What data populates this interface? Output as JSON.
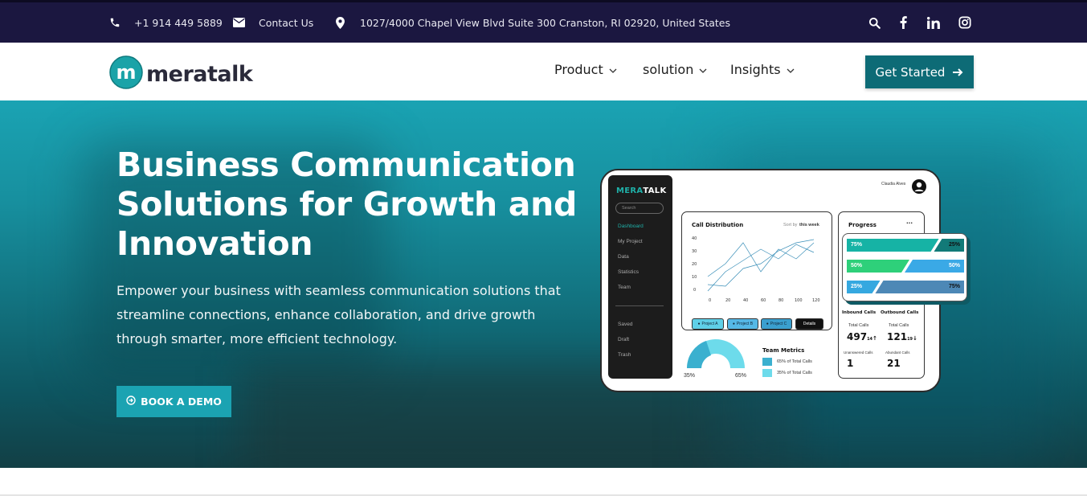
{
  "topbar": {
    "phone": "+1 914 449 5889",
    "contact": "Contact Us",
    "address": "1027/4000 Chapel View Blvd Suite 300 Cranston, RI 02920, United States",
    "icons": [
      "search-icon",
      "facebook-icon",
      "linkedin-icon",
      "instagram-icon"
    ]
  },
  "nav": {
    "logo_text": "meratalk",
    "items": [
      {
        "label": "Product"
      },
      {
        "label": "solution"
      },
      {
        "label": "Insights"
      }
    ],
    "cta_label": "Get Started"
  },
  "hero": {
    "title": "Business Communication Solutions for Growth and Innovation",
    "description": "Empower your business with seamless communication solutions that streamline connections, enhance collaboration, and drive growth through smarter, more efficient technology.",
    "button_label": "BOOK A DEMO"
  },
  "dashboard": {
    "brand_a": "MERA",
    "brand_b": "TALK",
    "user_name": "Claudia Alves",
    "search_placeholder": "Search",
    "sidebar": [
      "Dashboard",
      "My Project",
      "Data",
      "Statistics",
      "Team",
      "Saved",
      "Draft",
      "Trash"
    ],
    "call_distribution": {
      "title": "Call Distribution",
      "sort_label": "Sort by",
      "sort_value": "this week",
      "y_ticks": [
        "40",
        "30",
        "20",
        "10",
        "0"
      ],
      "x_ticks": [
        "0",
        "20",
        "40",
        "60",
        "80",
        "100",
        "120"
      ],
      "legend": [
        "Project A",
        "Project B",
        "Project C"
      ],
      "details_label": "Details"
    },
    "progress": {
      "title": "Progress",
      "more": "...",
      "rows": [
        {
          "left": "75%",
          "right": "25%",
          "left_value": 75
        },
        {
          "left": "50%",
          "right": "50%",
          "left_value": 50
        },
        {
          "left": "25%",
          "right": "75%",
          "left_value": 25
        }
      ]
    },
    "calls": {
      "inbound_title": "Inbound Calls",
      "outbound_title": "Outbound Calls",
      "total_label": "Total Calls",
      "inbound_total": "497",
      "inbound_delta": "14",
      "outbound_total": "121",
      "outbound_delta": "19",
      "unanswered_label": "Unanswered Calls",
      "abandoned_label": "Abundant Calls",
      "unanswered": "1",
      "abandoned": "21"
    },
    "team": {
      "left_pct": "35%",
      "right_pct": "65%",
      "title": "Team Metrics",
      "items": [
        "65% of Total Calls",
        "35% of Total Calls"
      ]
    }
  },
  "colors": {
    "topbar_bg": "#1b1740",
    "cta_bg": "#0d6b76",
    "demo_bg": "#1ba3b2",
    "accent_teal": "#1fb0a8"
  }
}
